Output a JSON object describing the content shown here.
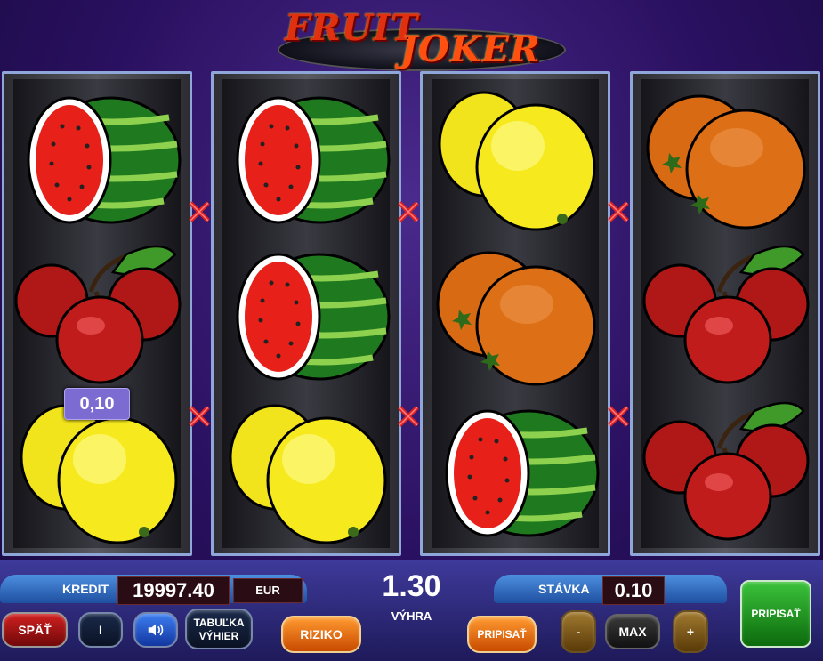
{
  "game": {
    "title_word1": "FRUIT",
    "title_word2": "JOKER"
  },
  "reels": [
    {
      "symbols": [
        "watermelon-icon",
        "cherries-icon",
        "lemon-icon"
      ]
    },
    {
      "symbols": [
        "watermelon-icon",
        "watermelon-icon",
        "lemon-icon"
      ]
    },
    {
      "symbols": [
        "lemon-icon",
        "orange-icon",
        "watermelon-icon"
      ]
    },
    {
      "symbols": [
        "orange-icon",
        "cherries-icon",
        "cherries-icon"
      ]
    }
  ],
  "line_win": {
    "value": "0,10"
  },
  "credit": {
    "label": "KREDIT",
    "value": "19997.40",
    "currency": "EUR"
  },
  "win": {
    "value": "1.30",
    "label": "VÝHRA"
  },
  "bet": {
    "label": "STÁVKA",
    "value": "0.10"
  },
  "buttons": {
    "back": "SPÄŤ",
    "info": "I",
    "paytable_line1": "TABUĽKA",
    "paytable_line2": "VÝHIER",
    "risk": "RIZIKO",
    "collect": "PRIPISAŤ",
    "minus": "-",
    "max": "MAX",
    "plus": "+",
    "collect_big": "PRIPISAŤ"
  },
  "colors": {
    "reel_border": "#8fa6d8",
    "win_box": "#7c6bd0",
    "background": "#2a1060"
  }
}
